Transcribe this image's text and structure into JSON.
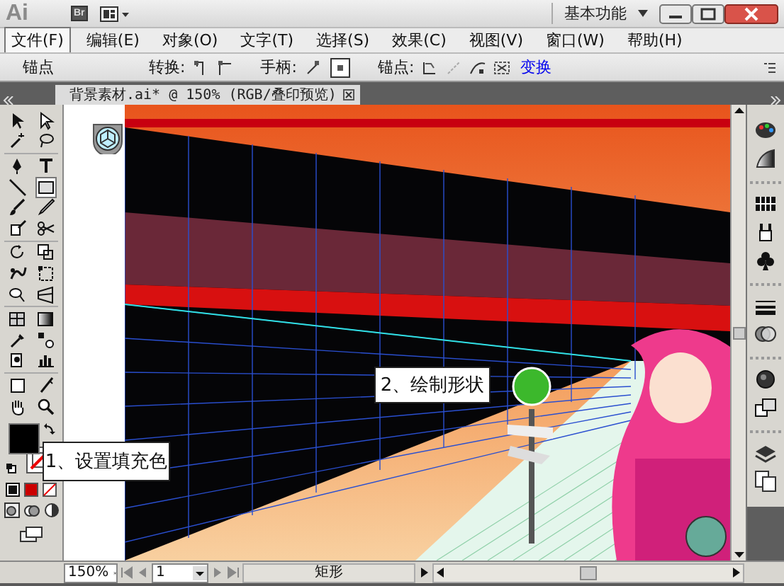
{
  "title_bar": {
    "logo": "Ai",
    "bridge_button": "Br",
    "workspace": "基本功能"
  },
  "menu": [
    {
      "label": "文件(F)",
      "selected": true
    },
    {
      "label": "编辑(E)",
      "selected": false
    },
    {
      "label": "对象(O)",
      "selected": false
    },
    {
      "label": "文字(T)",
      "selected": false
    },
    {
      "label": "选择(S)",
      "selected": false
    },
    {
      "label": "效果(C)",
      "selected": false
    },
    {
      "label": "视图(V)",
      "selected": false
    },
    {
      "label": "窗口(W)",
      "selected": false
    },
    {
      "label": "帮助(H)",
      "selected": false
    }
  ],
  "control_bar": {
    "title": "锚点",
    "convert_label": "转换:",
    "handles_label": "手柄:",
    "handle_buttons": [
      {
        "selected": false
      },
      {
        "selected": true
      }
    ],
    "anchors_label": "锚点:",
    "transform_link": "变换"
  },
  "document_tab": {
    "title": "背景素材.ai* @ 150% (RGB/叠印预览)"
  },
  "toolbox": {
    "tools": [
      {
        "selected": false
      },
      {
        "selected": false
      },
      {
        "selected": false
      },
      {
        "selected": false
      },
      {
        "selected": false
      },
      {
        "selected": false
      },
      {
        "selected": false
      },
      {
        "selected": true
      },
      {
        "selected": false
      },
      {
        "selected": false
      },
      {
        "selected": false
      },
      {
        "selected": false
      },
      {
        "selected": false
      },
      {
        "selected": false
      },
      {
        "selected": false
      },
      {
        "selected": false
      },
      {
        "selected": false
      },
      {
        "selected": false
      },
      {
        "selected": false
      },
      {
        "selected": false
      },
      {
        "selected": false
      },
      {
        "selected": false
      },
      {
        "selected": false
      },
      {
        "selected": false
      },
      {
        "selected": false
      },
      {
        "selected": false
      },
      {
        "selected": false
      },
      {
        "selected": false
      }
    ]
  },
  "status_bar": {
    "zoom": "150%",
    "page": "1",
    "current_tool": "矩形"
  },
  "callouts": [
    {
      "text": "1、设置填充色"
    },
    {
      "text": "2、绘制形状"
    }
  ]
}
